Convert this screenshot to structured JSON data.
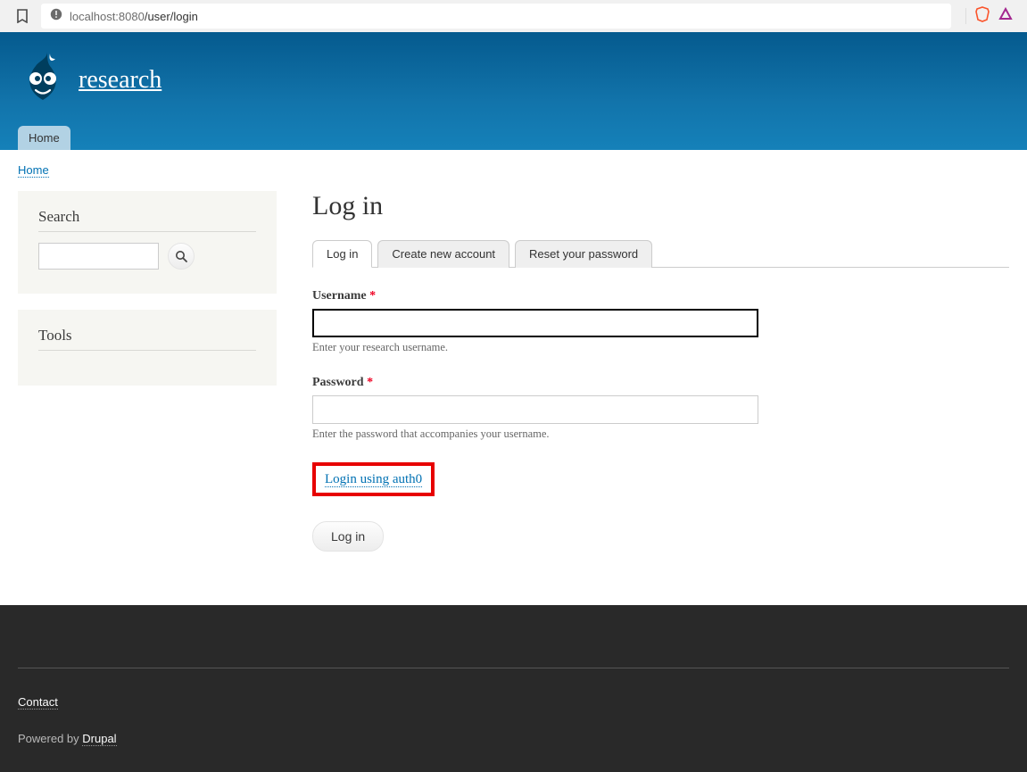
{
  "browser": {
    "url_host": "localhost:8080",
    "url_path": "/user/login"
  },
  "site": {
    "name": "research",
    "nav_home": "Home"
  },
  "breadcrumb": {
    "home": "Home"
  },
  "sidebar": {
    "search_title": "Search",
    "tools_title": "Tools"
  },
  "page": {
    "title": "Log in",
    "tabs": {
      "login": "Log in",
      "create": "Create new account",
      "reset": "Reset your password"
    },
    "username_label": "Username",
    "username_desc": "Enter your research username.",
    "password_label": "Password",
    "password_desc": "Enter the password that accompanies your username.",
    "auth0_link": "Login using auth0",
    "submit": "Log in",
    "required_mark": "*"
  },
  "footer": {
    "contact": "Contact",
    "powered_prefix": "Powered by ",
    "powered_link": "Drupal"
  }
}
